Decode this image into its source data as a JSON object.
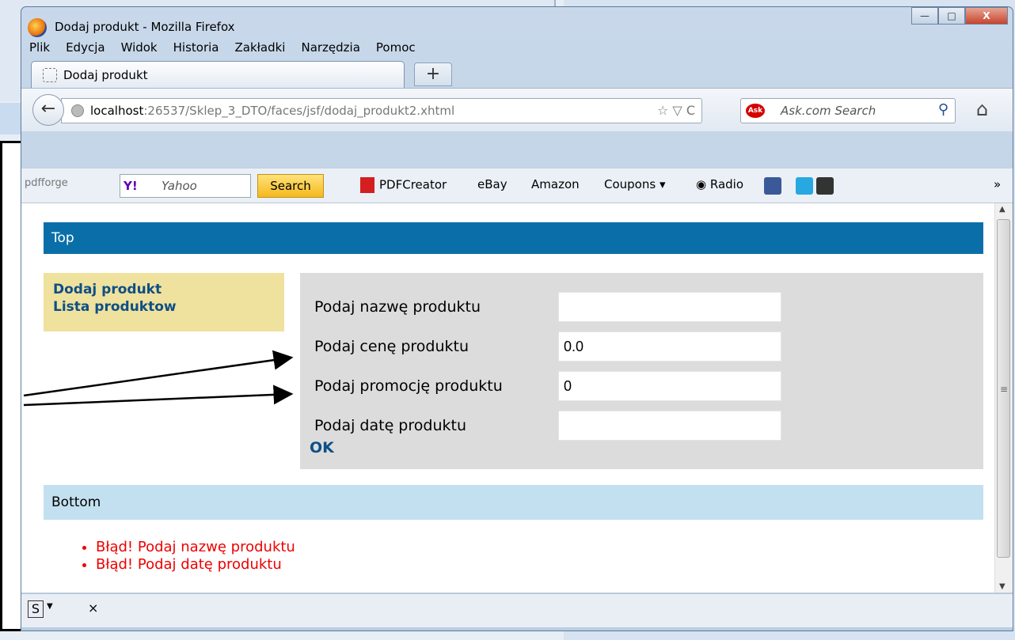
{
  "window": {
    "title": "Dodaj produkt - Mozilla Firefox",
    "controls": {
      "minimize": "—",
      "maximize": "□",
      "close": "X"
    }
  },
  "menu": [
    "Plik",
    "Edycja",
    "Widok",
    "Historia",
    "Zakładki",
    "Narzędzia",
    "Pomoc"
  ],
  "tab": {
    "label": "Dodaj produkt",
    "new_tab": "+"
  },
  "nav": {
    "back": "←",
    "url_host": "localhost",
    "url_rest": ":26537/Sklep_3_DTO/faces/jsf/dodaj_produkt2.xhtml",
    "url_icons": "☆ ▽ C",
    "search_placeholder": "Ask.com Search",
    "search_engine_badge": "Ask",
    "home": "⌂"
  },
  "toolbar": {
    "pdfforge": "pdfforge",
    "yahoo_logo": "Y!",
    "yahoo_placeholder": "Yahoo",
    "search_button": "Search",
    "pdfcreator": "PDFCreator",
    "ebay": "eBay",
    "amazon": "Amazon",
    "coupons": "Coupons",
    "radio": "Radio",
    "more": "»"
  },
  "page": {
    "top_header": "Top",
    "nav_links": [
      "Dodaj produkt",
      "Lista produktow"
    ],
    "form": {
      "fields": [
        {
          "label": "Podaj nazwę produktu",
          "value": ""
        },
        {
          "label": "Podaj cenę produktu",
          "value": "0.0"
        },
        {
          "label": "Podaj promocję produktu",
          "value": "0"
        },
        {
          "label": "Podaj datę produktu",
          "value": ""
        }
      ],
      "submit": "OK"
    },
    "bottom_header": "Bottom",
    "errors": [
      "Błąd! Podaj nazwę produktu",
      "Błąd! Podaj datę produktu"
    ]
  },
  "statusbar": {
    "close": "×",
    "s_icon": "S"
  },
  "colors": {
    "top_header_bg": "#0a6fa8",
    "nav_bg": "#efe19e",
    "form_bg": "#dcdcdc",
    "bottom_header_bg": "#c3e0f0",
    "error_text": "#ee0000",
    "link_text": "#0d4f86"
  }
}
